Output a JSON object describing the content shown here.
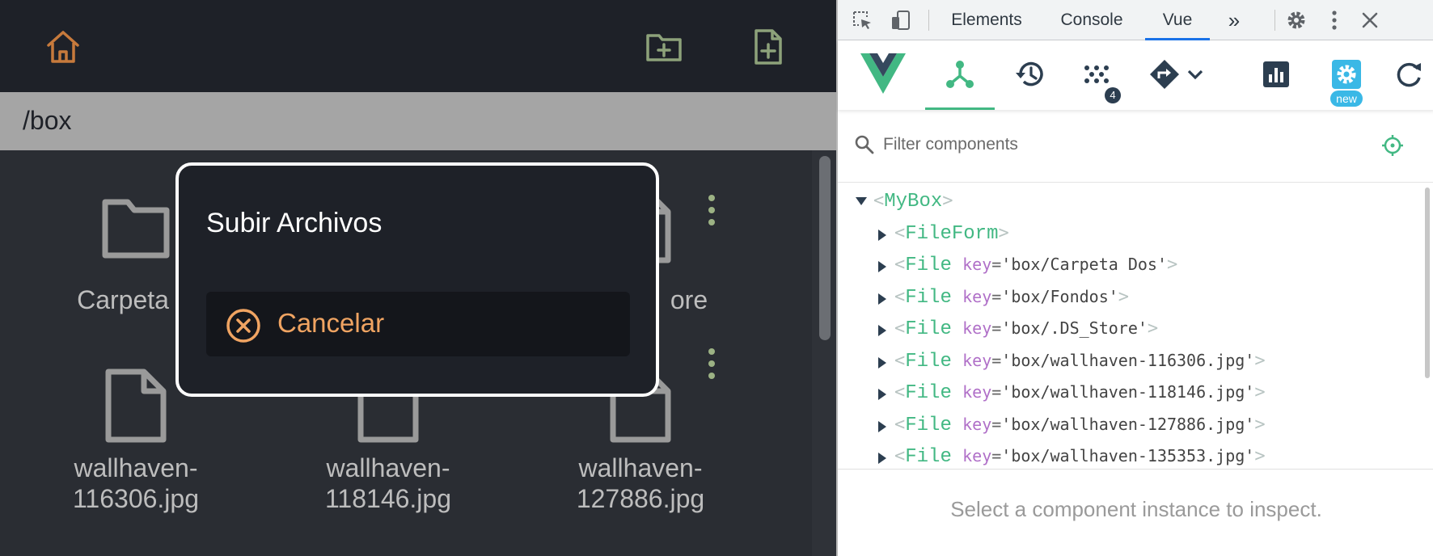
{
  "app": {
    "path": "/box",
    "items": [
      {
        "name": "Carpeta D",
        "type": "folder"
      },
      {
        "name": "",
        "type": "file"
      },
      {
        "name": "ore",
        "type": "file"
      },
      {
        "name": "wallhaven-\n116306.jpg",
        "type": "file"
      },
      {
        "name": "wallhaven-\n118146.jpg",
        "type": "file"
      },
      {
        "name": "wallhaven-\n127886.jpg",
        "type": "file"
      }
    ],
    "colors": {
      "home_icon": "#c77a3c",
      "add_icon": "#8da27a",
      "kebab": "#9cb284"
    }
  },
  "dialog": {
    "title": "Subir Archivos",
    "cancel_label": "Cancelar"
  },
  "devtools": {
    "tabs": [
      "Elements",
      "Console",
      "Vue"
    ],
    "active_tab": "Vue",
    "more_tabs_label": "»",
    "badges": {
      "events": "4",
      "settings": "new"
    },
    "filter": {
      "placeholder": "Filter components",
      "value": ""
    },
    "tree": [
      {
        "name": "MyBox",
        "expanded": true,
        "depth": 0,
        "key_attr": "",
        "key_value": ""
      },
      {
        "name": "FileForm",
        "expanded": false,
        "depth": 1,
        "key_attr": "",
        "key_value": ""
      },
      {
        "name": "File",
        "expanded": false,
        "depth": 1,
        "key_attr": "key",
        "key_value": "'box/Carpeta Dos'"
      },
      {
        "name": "File",
        "expanded": false,
        "depth": 1,
        "key_attr": "key",
        "key_value": "'box/Fondos'"
      },
      {
        "name": "File",
        "expanded": false,
        "depth": 1,
        "key_attr": "key",
        "key_value": "'box/.DS_Store'"
      },
      {
        "name": "File",
        "expanded": false,
        "depth": 1,
        "key_attr": "key",
        "key_value": "'box/wallhaven-116306.jpg'"
      },
      {
        "name": "File",
        "expanded": false,
        "depth": 1,
        "key_attr": "key",
        "key_value": "'box/wallhaven-118146.jpg'"
      },
      {
        "name": "File",
        "expanded": false,
        "depth": 1,
        "key_attr": "key",
        "key_value": "'box/wallhaven-127886.jpg'"
      },
      {
        "name": "File",
        "expanded": false,
        "depth": 1,
        "key_attr": "key",
        "key_value": "'box/wallhaven-135353.jpg'"
      }
    ],
    "inspector_message": "Select a component instance to inspect.",
    "colors": {
      "vue_green": "#42b883",
      "vue_dark": "#35495e",
      "tab_underline": "#1a73e8"
    }
  }
}
